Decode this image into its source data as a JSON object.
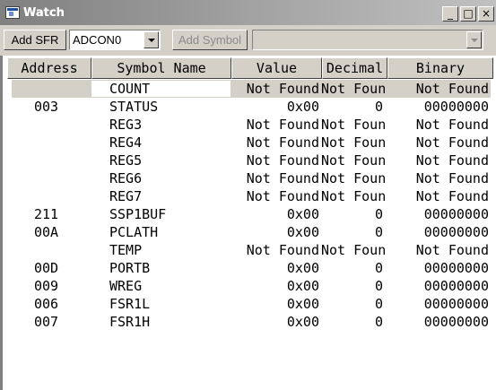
{
  "window": {
    "title": "Watch",
    "minimize_label": "_",
    "maximize_label": "□",
    "close_label": "×"
  },
  "toolbar": {
    "add_sfr_label": "Add SFR",
    "sfr_selected": "ADCON0",
    "add_symbol_label": "Add Symbol",
    "symbol_selected": ""
  },
  "columns": [
    "Address",
    "Symbol Name",
    "Value",
    "Decimal",
    "Binary"
  ],
  "rows": [
    {
      "address": "",
      "symbol": "COUNT",
      "value": "Not Found",
      "decimal": "Not Found",
      "binary": "Not Found",
      "selected": true
    },
    {
      "address": "003",
      "symbol": "STATUS",
      "value": "0x00",
      "decimal": "0",
      "binary": "00000000"
    },
    {
      "address": "",
      "symbol": "REG3",
      "value": "Not Found",
      "decimal": "Not Found",
      "binary": "Not Found"
    },
    {
      "address": "",
      "symbol": "REG4",
      "value": "Not Found",
      "decimal": "Not Found",
      "binary": "Not Found"
    },
    {
      "address": "",
      "symbol": "REG5",
      "value": "Not Found",
      "decimal": "Not Found",
      "binary": "Not Found"
    },
    {
      "address": "",
      "symbol": "REG6",
      "value": "Not Found",
      "decimal": "Not Found",
      "binary": "Not Found"
    },
    {
      "address": "",
      "symbol": "REG7",
      "value": "Not Found",
      "decimal": "Not Found",
      "binary": "Not Found"
    },
    {
      "address": "211",
      "symbol": "SSP1BUF",
      "value": "0x00",
      "decimal": "0",
      "binary": "00000000"
    },
    {
      "address": "00A",
      "symbol": "PCLATH",
      "value": "0x00",
      "decimal": "0",
      "binary": "00000000"
    },
    {
      "address": "",
      "symbol": "TEMP",
      "value": "Not Found",
      "decimal": "Not Found",
      "binary": "Not Found"
    },
    {
      "address": "00D",
      "symbol": "PORTB",
      "value": "0x00",
      "decimal": "0",
      "binary": "00000000"
    },
    {
      "address": "009",
      "symbol": "WREG",
      "value": "0x00",
      "decimal": "0",
      "binary": "00000000"
    },
    {
      "address": "006",
      "symbol": "FSR1L",
      "value": "0x00",
      "decimal": "0",
      "binary": "00000000"
    },
    {
      "address": "007",
      "symbol": "FSR1H",
      "value": "0x00",
      "decimal": "0",
      "binary": "00000000"
    }
  ]
}
